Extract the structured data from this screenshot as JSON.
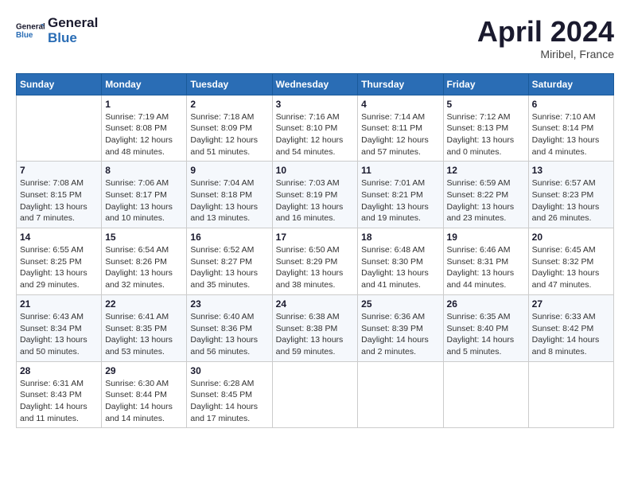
{
  "logo": {
    "text_general": "General",
    "text_blue": "Blue"
  },
  "header": {
    "month_year": "April 2024",
    "location": "Miribel, France"
  },
  "days_of_week": [
    "Sunday",
    "Monday",
    "Tuesday",
    "Wednesday",
    "Thursday",
    "Friday",
    "Saturday"
  ],
  "weeks": [
    [
      {
        "day": "",
        "info": ""
      },
      {
        "day": "1",
        "info": "Sunrise: 7:19 AM\nSunset: 8:08 PM\nDaylight: 12 hours\nand 48 minutes."
      },
      {
        "day": "2",
        "info": "Sunrise: 7:18 AM\nSunset: 8:09 PM\nDaylight: 12 hours\nand 51 minutes."
      },
      {
        "day": "3",
        "info": "Sunrise: 7:16 AM\nSunset: 8:10 PM\nDaylight: 12 hours\nand 54 minutes."
      },
      {
        "day": "4",
        "info": "Sunrise: 7:14 AM\nSunset: 8:11 PM\nDaylight: 12 hours\nand 57 minutes."
      },
      {
        "day": "5",
        "info": "Sunrise: 7:12 AM\nSunset: 8:13 PM\nDaylight: 13 hours\nand 0 minutes."
      },
      {
        "day": "6",
        "info": "Sunrise: 7:10 AM\nSunset: 8:14 PM\nDaylight: 13 hours\nand 4 minutes."
      }
    ],
    [
      {
        "day": "7",
        "info": "Sunrise: 7:08 AM\nSunset: 8:15 PM\nDaylight: 13 hours\nand 7 minutes."
      },
      {
        "day": "8",
        "info": "Sunrise: 7:06 AM\nSunset: 8:17 PM\nDaylight: 13 hours\nand 10 minutes."
      },
      {
        "day": "9",
        "info": "Sunrise: 7:04 AM\nSunset: 8:18 PM\nDaylight: 13 hours\nand 13 minutes."
      },
      {
        "day": "10",
        "info": "Sunrise: 7:03 AM\nSunset: 8:19 PM\nDaylight: 13 hours\nand 16 minutes."
      },
      {
        "day": "11",
        "info": "Sunrise: 7:01 AM\nSunset: 8:21 PM\nDaylight: 13 hours\nand 19 minutes."
      },
      {
        "day": "12",
        "info": "Sunrise: 6:59 AM\nSunset: 8:22 PM\nDaylight: 13 hours\nand 23 minutes."
      },
      {
        "day": "13",
        "info": "Sunrise: 6:57 AM\nSunset: 8:23 PM\nDaylight: 13 hours\nand 26 minutes."
      }
    ],
    [
      {
        "day": "14",
        "info": "Sunrise: 6:55 AM\nSunset: 8:25 PM\nDaylight: 13 hours\nand 29 minutes."
      },
      {
        "day": "15",
        "info": "Sunrise: 6:54 AM\nSunset: 8:26 PM\nDaylight: 13 hours\nand 32 minutes."
      },
      {
        "day": "16",
        "info": "Sunrise: 6:52 AM\nSunset: 8:27 PM\nDaylight: 13 hours\nand 35 minutes."
      },
      {
        "day": "17",
        "info": "Sunrise: 6:50 AM\nSunset: 8:29 PM\nDaylight: 13 hours\nand 38 minutes."
      },
      {
        "day": "18",
        "info": "Sunrise: 6:48 AM\nSunset: 8:30 PM\nDaylight: 13 hours\nand 41 minutes."
      },
      {
        "day": "19",
        "info": "Sunrise: 6:46 AM\nSunset: 8:31 PM\nDaylight: 13 hours\nand 44 minutes."
      },
      {
        "day": "20",
        "info": "Sunrise: 6:45 AM\nSunset: 8:32 PM\nDaylight: 13 hours\nand 47 minutes."
      }
    ],
    [
      {
        "day": "21",
        "info": "Sunrise: 6:43 AM\nSunset: 8:34 PM\nDaylight: 13 hours\nand 50 minutes."
      },
      {
        "day": "22",
        "info": "Sunrise: 6:41 AM\nSunset: 8:35 PM\nDaylight: 13 hours\nand 53 minutes."
      },
      {
        "day": "23",
        "info": "Sunrise: 6:40 AM\nSunset: 8:36 PM\nDaylight: 13 hours\nand 56 minutes."
      },
      {
        "day": "24",
        "info": "Sunrise: 6:38 AM\nSunset: 8:38 PM\nDaylight: 13 hours\nand 59 minutes."
      },
      {
        "day": "25",
        "info": "Sunrise: 6:36 AM\nSunset: 8:39 PM\nDaylight: 14 hours\nand 2 minutes."
      },
      {
        "day": "26",
        "info": "Sunrise: 6:35 AM\nSunset: 8:40 PM\nDaylight: 14 hours\nand 5 minutes."
      },
      {
        "day": "27",
        "info": "Sunrise: 6:33 AM\nSunset: 8:42 PM\nDaylight: 14 hours\nand 8 minutes."
      }
    ],
    [
      {
        "day": "28",
        "info": "Sunrise: 6:31 AM\nSunset: 8:43 PM\nDaylight: 14 hours\nand 11 minutes."
      },
      {
        "day": "29",
        "info": "Sunrise: 6:30 AM\nSunset: 8:44 PM\nDaylight: 14 hours\nand 14 minutes."
      },
      {
        "day": "30",
        "info": "Sunrise: 6:28 AM\nSunset: 8:45 PM\nDaylight: 14 hours\nand 17 minutes."
      },
      {
        "day": "",
        "info": ""
      },
      {
        "day": "",
        "info": ""
      },
      {
        "day": "",
        "info": ""
      },
      {
        "day": "",
        "info": ""
      }
    ]
  ]
}
